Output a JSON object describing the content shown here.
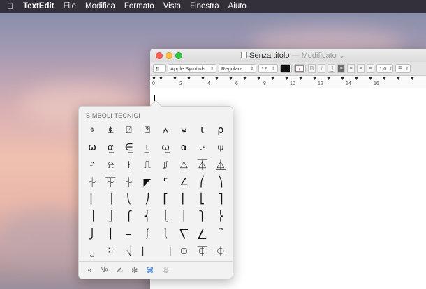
{
  "menubar": {
    "apple_icon": "",
    "app": "TextEdit",
    "items": [
      "File",
      "Modifica",
      "Formato",
      "Vista",
      "Finestra",
      "Aiuto"
    ]
  },
  "window": {
    "title": "Senza titolo",
    "title_suffix": "— Modificato",
    "toolbar": {
      "paragraph_style": "¶",
      "font_family": "Apple Symbols",
      "font_style": "Regolare",
      "font_size": "12",
      "line_spacing": "1,0",
      "list_style": "☰"
    },
    "ruler": {
      "numbers": [
        "0",
        "2",
        "4",
        "6",
        "8",
        "10",
        "12",
        "14",
        "16"
      ]
    }
  },
  "character_viewer": {
    "category_title": "SIMBOLI TECNICI",
    "symbols": [
      "⌖",
      "⍎",
      "⍁",
      "⍰",
      "⍲",
      "⍱",
      "ɩ",
      "ρ",
      "ω",
      "α̲",
      "∈̲",
      "ɩ̲",
      "ω̲",
      "α",
      "⍻",
      "⍦",
      "⍨",
      "⍾",
      "⍿",
      "⎍",
      "⎎",
      "⏃",
      "⏄",
      "⏅",
      "⏆",
      "⏇",
      "⏈",
      "◤",
      "⌜",
      "∠",
      "⎛",
      "⎞",
      "⎜",
      "⎟",
      "⎝",
      "⎠",
      "⎡",
      "⎢",
      "⎣",
      "⎤",
      "⎥",
      "⎦",
      "⎧",
      "⎨",
      "⎩",
      "⎪",
      "⎫",
      "⎬",
      "⎭",
      "⎮",
      "⎯",
      "⎰",
      "⎱",
      "⎲",
      "⎳",
      "⎴",
      "⎵",
      "⎶",
      "⎷",
      "⎸",
      "⎹",
      "⏀",
      "⏁",
      "⏂"
    ],
    "bottom_tabs": [
      "«",
      "№",
      "✍",
      "✻",
      "⌘",
      "♲"
    ],
    "active_tab_index": 4
  }
}
